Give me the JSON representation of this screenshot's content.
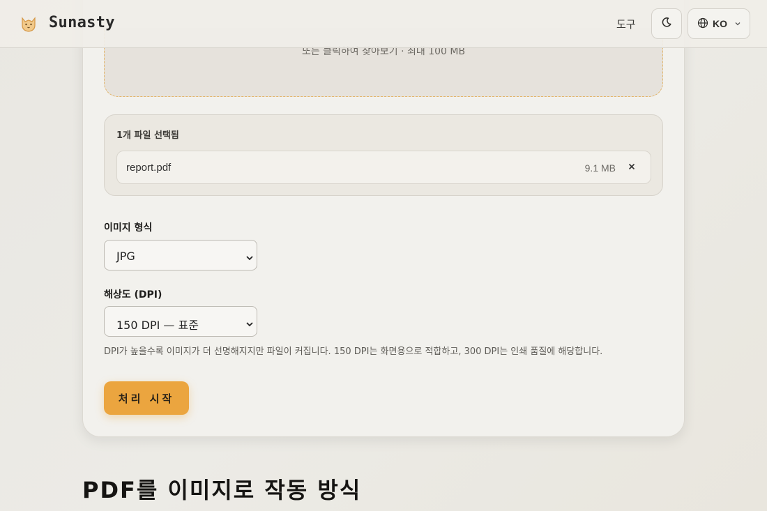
{
  "header": {
    "brand": "Sunasty",
    "nav_tools": "도구",
    "theme_icon": "moon-icon",
    "lang_icon": "globe-icon",
    "lang_label": "KO",
    "lang_chevron": "chevron-down-icon"
  },
  "dropzone": {
    "hint": "또는 클릭하여 찾아보기 · 최대 100 MB"
  },
  "files": {
    "count_label": "1개 파일 선택됨",
    "items": [
      {
        "name": "report.pdf",
        "size": "9.1 MB"
      }
    ]
  },
  "options": {
    "format_label": "이미지 형식",
    "format_value": "JPG",
    "dpi_label": "해상도 (DPI)",
    "dpi_value": "150 DPI — 표준",
    "dpi_help": "DPI가 높을수록 이미지가 더 선명해지지만 파일이 커집니다. 150 DPI는 화면용으로 적합하고, 300 DPI는 인쇄 품질에 해당합니다."
  },
  "actions": {
    "start_label": "처리 시작"
  },
  "section": {
    "title": "PDF를 이미지로 작동 방식"
  },
  "colors": {
    "accent": "#eba53f",
    "dropzone_border": "#e3b56a"
  }
}
